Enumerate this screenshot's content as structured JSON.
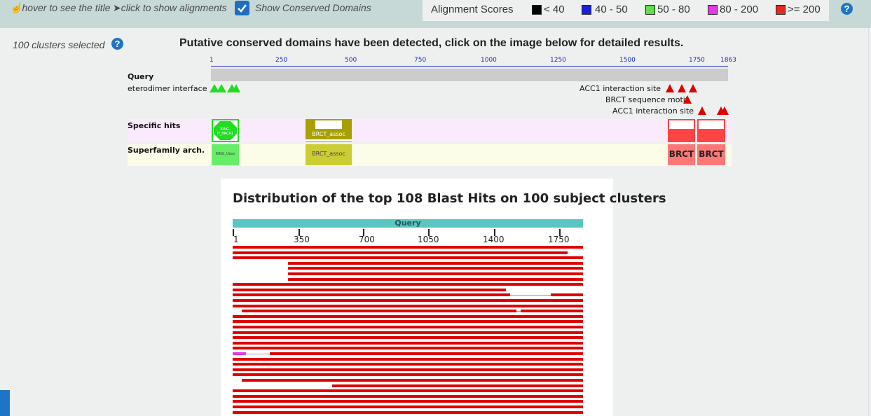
{
  "toolbar": {
    "hover_hint": "hover to see the title",
    "click_hint": "click to show alignments",
    "show_cd_label": "Show Conserved Domains",
    "show_cd_checked": true
  },
  "legend": {
    "title": "Alignment Scores",
    "ranges": [
      {
        "label": "< 40",
        "color": "#000000"
      },
      {
        "label": "40 - 50",
        "color": "#1a22d8"
      },
      {
        "label": "50 - 80",
        "color": "#5ee04a"
      },
      {
        "label": "80 - 200",
        "color": "#e23ae0"
      },
      {
        "label": ">= 200",
        "color": "#e22a22"
      }
    ]
  },
  "sidebar": {
    "clusters_selected": "100 clusters selected"
  },
  "conserved_domains": {
    "title": "Putative conserved domains have been detected, click on the image below for detailed results.",
    "scale_ticks": [
      "1",
      "250",
      "500",
      "750",
      "1000",
      "1250",
      "1500",
      "1750",
      "1863"
    ],
    "rows": {
      "query": "Query",
      "heterodimer": "eterodimer interface",
      "acc1_a": "ACC1 interaction site",
      "brct_motif": "BRCT sequence motif",
      "acc1_b": "ACC1 interaction site",
      "specific_hits": "Specific hits",
      "superfamily": "Superfamily arch."
    },
    "domains": {
      "ring_specific": "RING-H_BRCA1",
      "ring_super": "RING_Ubox",
      "brct_assoc_specific": "BRCT_assoc",
      "brct_assoc_super": "BRCT_assoc",
      "brct1": "BRCT",
      "brct2": "BRCT"
    },
    "colors": {
      "specific_bg": "#fbeafc",
      "superfamily_bg": "#fcfde8",
      "query_bar": "#cccccc",
      "ring": "#22dd22",
      "brct_assoc": "#a8a000",
      "brct": "#ff4444"
    }
  },
  "blast": {
    "title": "Distribution of the top 108 Blast Hits on 100 subject clusters",
    "query_label": "Query",
    "axis_ticks": [
      "1",
      "350",
      "700",
      "1050",
      "1400",
      "1750"
    ],
    "query_length": 1863,
    "hits": [
      {
        "start": 1,
        "end": 1863
      },
      {
        "start": 1,
        "end": 1780
      },
      {
        "start": 1,
        "end": 1863
      },
      {
        "start": 295,
        "end": 1863
      },
      {
        "start": 295,
        "end": 1863
      },
      {
        "start": 295,
        "end": 1863
      },
      {
        "start": 295,
        "end": 1863
      },
      {
        "start": 1,
        "end": 1863
      },
      {
        "start": 1,
        "end": 1455
      },
      {
        "start": 1,
        "end": 1475,
        "start2": 1690,
        "end2": 1863
      },
      {
        "start": 1,
        "end": 1863
      },
      {
        "start": 1,
        "end": 1863
      },
      {
        "start": 48,
        "end": 1510,
        "start2": 1530,
        "end2": 1863
      },
      {
        "start": 1,
        "end": 1863
      },
      {
        "start": 1,
        "end": 1863
      },
      {
        "start": 1,
        "end": 1863
      },
      {
        "start": 1,
        "end": 1863
      },
      {
        "start": 1,
        "end": 1863
      },
      {
        "start": 1,
        "end": 1863
      },
      {
        "start": 1,
        "end": 1863
      },
      {
        "start": 1,
        "end": 70,
        "color": "#e23ae0",
        "start2": 200,
        "end2": 1863
      },
      {
        "start": 1,
        "end": 1863
      },
      {
        "start": 1,
        "end": 1863
      },
      {
        "start": 1,
        "end": 1863
      },
      {
        "start": 1,
        "end": 1863
      },
      {
        "start": 48,
        "end": 1863
      },
      {
        "start": 530,
        "end": 1863
      },
      {
        "start": 1,
        "end": 1863
      },
      {
        "start": 1,
        "end": 1863
      },
      {
        "start": 1,
        "end": 1863
      },
      {
        "start": 1,
        "end": 1863
      },
      {
        "start": 1,
        "end": 1863
      }
    ]
  }
}
